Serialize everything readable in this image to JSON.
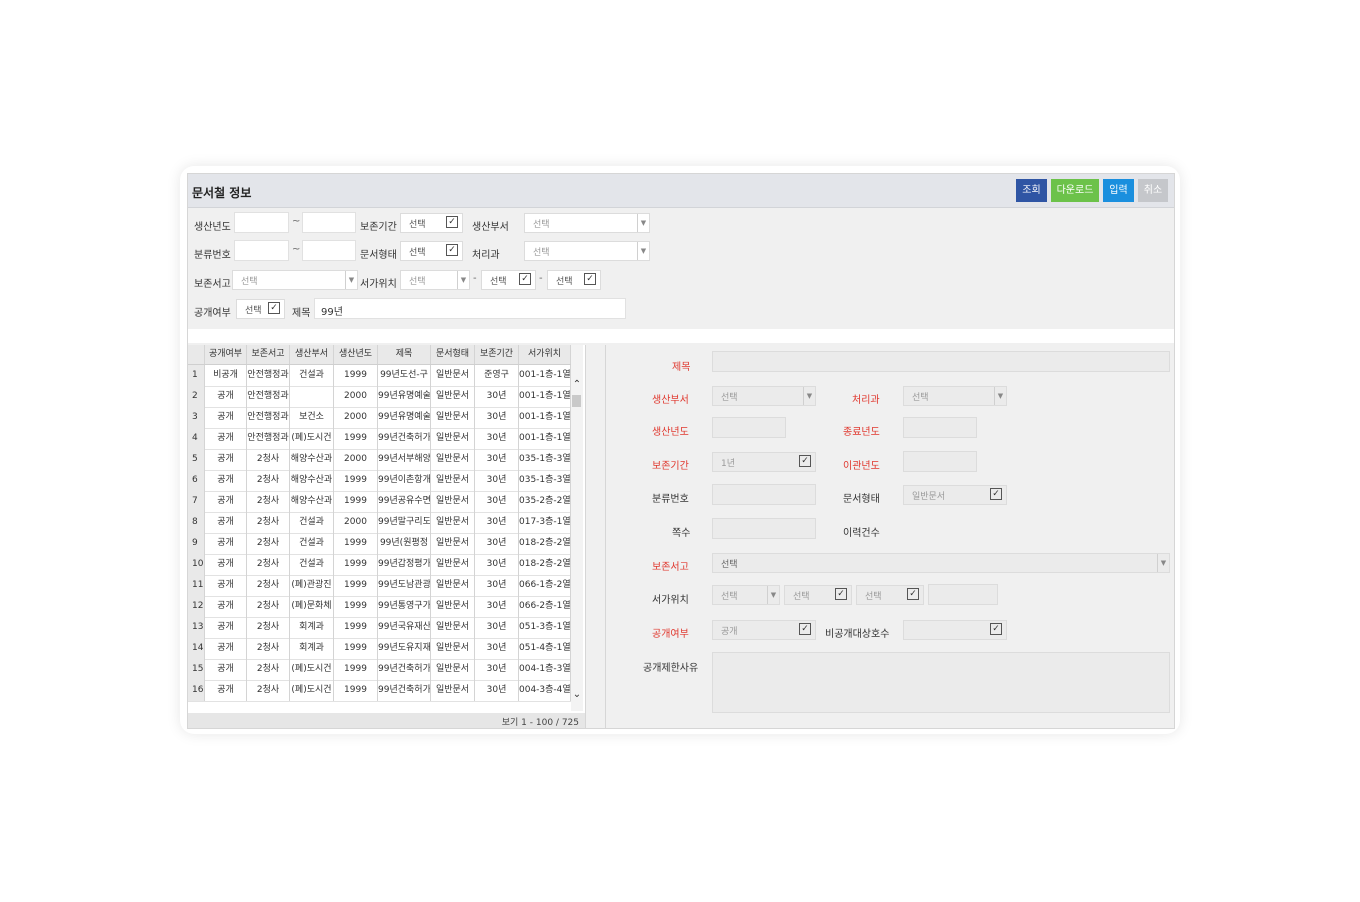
{
  "header": {
    "title": "문서철 정보",
    "buttons": {
      "search": "조회",
      "download": "다운로드",
      "input": "입력",
      "cancel": "취소"
    },
    "colors": {
      "search": "#2f55a4",
      "download": "#6cc24a",
      "input": "#1a8fde",
      "cancel": "#c5c7cb"
    }
  },
  "filters": {
    "production_year": "생산년도",
    "retention_period": "보존기간",
    "production_dept": "생산부서",
    "classification_no": "분류번호",
    "document_type": "문서형태",
    "processing_dept": "처리과",
    "storage": "보존서고",
    "shelf_location": "서가위치",
    "disclosure": "공개여부",
    "subject": "제목",
    "subject_value": "99년",
    "select": "선택",
    "dash": "~",
    "hyphen": "-",
    "check_glyph": "✓",
    "arrow_glyph": "▼"
  },
  "grid": {
    "columns": [
      "공개여부",
      "보존서고",
      "생산부서",
      "생산년도",
      "제목",
      "문서형태",
      "보존기간",
      "서가위치"
    ],
    "rows": [
      [
        "1",
        "비공개",
        "안전행정과",
        "건설과",
        "1999",
        "99년도선-구",
        "일반문서",
        "준영구",
        "001-1층-1열"
      ],
      [
        "2",
        "공개",
        "안전행정과",
        "",
        "2000",
        "99년유명예술",
        "일반문서",
        "30년",
        "001-1층-1열"
      ],
      [
        "3",
        "공개",
        "안전행정과",
        "보건소",
        "2000",
        "99년유명예술",
        "일반문서",
        "30년",
        "001-1층-1열"
      ],
      [
        "4",
        "공개",
        "안전행정과",
        "(폐)도시건",
        "1999",
        "99년건축허가",
        "일반문서",
        "30년",
        "001-1층-1열"
      ],
      [
        "5",
        "공개",
        "2청사",
        "해양수산과",
        "2000",
        "99년서부해양",
        "일반문서",
        "30년",
        "035-1층-3열"
      ],
      [
        "6",
        "공개",
        "2청사",
        "해양수산과",
        "1999",
        "99년이촌항개",
        "일반문서",
        "30년",
        "035-1층-3열"
      ],
      [
        "7",
        "공개",
        "2청사",
        "해양수산과",
        "1999",
        "99년공유수면",
        "일반문서",
        "30년",
        "035-2층-2열"
      ],
      [
        "8",
        "공개",
        "2청사",
        "건설과",
        "2000",
        "99년말구리도",
        "일반문서",
        "30년",
        "017-3층-1열"
      ],
      [
        "9",
        "공개",
        "2청사",
        "건설과",
        "1999",
        "99년(원평정",
        "일반문서",
        "30년",
        "018-2층-2열"
      ],
      [
        "10",
        "공개",
        "2청사",
        "건설과",
        "1999",
        "99년갑정평가",
        "일반문서",
        "30년",
        "018-2층-2열"
      ],
      [
        "11",
        "공개",
        "2청사",
        "(폐)관광진",
        "1999",
        "99년도남관광",
        "일반문서",
        "30년",
        "066-1층-2열"
      ],
      [
        "12",
        "공개",
        "2청사",
        "(폐)문화체",
        "1999",
        "99년통영구가",
        "일반문서",
        "30년",
        "066-2층-1열"
      ],
      [
        "13",
        "공개",
        "2청사",
        "회계과",
        "1999",
        "99년국유재산",
        "일반문서",
        "30년",
        "051-3층-1열"
      ],
      [
        "14",
        "공개",
        "2청사",
        "회계과",
        "1999",
        "99년도유지재",
        "일반문서",
        "30년",
        "051-4층-1열"
      ],
      [
        "15",
        "공개",
        "2청사",
        "(폐)도시건",
        "1999",
        "99년건축허가",
        "일반문서",
        "30년",
        "004-1층-3열"
      ],
      [
        "16",
        "공개",
        "2청사",
        "(폐)도시건",
        "1999",
        "99년건축허가",
        "일반문서",
        "30년",
        "004-3층-4열"
      ]
    ],
    "footer": "보기 1 - 100 / 725",
    "scroll_up": "⌃",
    "scroll_down": "⌄"
  },
  "detail": {
    "title": "제목",
    "production_dept": "생산부서",
    "processing_dept": "처리과",
    "production_year": "생산년도",
    "end_year": "종료년도",
    "retention_period": "보존기간",
    "retention_value": "1년",
    "transfer_year": "이관년도",
    "classification_no": "분류번호",
    "document_type": "문서형태",
    "document_type_value": "일반문서",
    "pages": "쪽수",
    "history_count": "이력건수",
    "storage": "보존서고",
    "shelf_location": "서가위치",
    "disclosure": "공개여부",
    "disclosure_value": "공개",
    "nondisclosure_no": "비공개대상호수",
    "restriction_reason": "공개제한사유",
    "select": "선택",
    "required_color": "#e0382e"
  }
}
